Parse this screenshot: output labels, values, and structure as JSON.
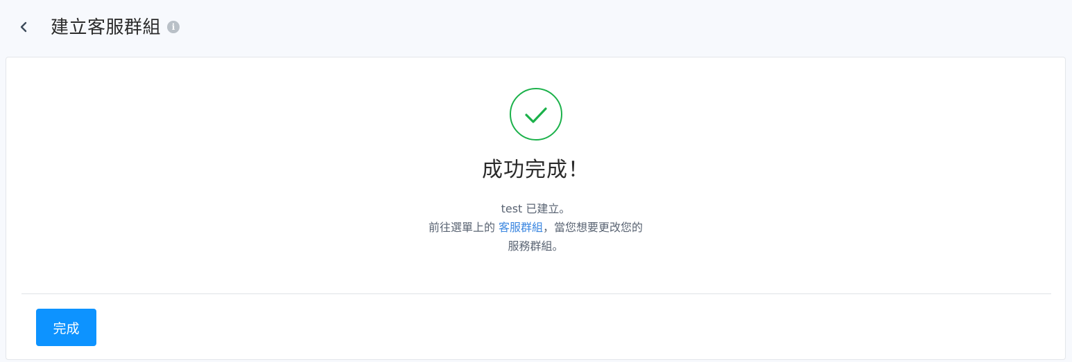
{
  "header": {
    "back_icon": "chevron-left-icon",
    "title": "建立客服群組",
    "info_icon": "info-icon",
    "info_glyph": "i"
  },
  "result": {
    "status_icon": "check-circle-icon",
    "status_color": "#1bb14a",
    "title": "成功完成！",
    "message_name": "test",
    "message_created": " 已建立。",
    "message_line2_prefix": "前往選單上的 ",
    "message_link": "客服群組",
    "message_line2_suffix": "，當您想要更改您的",
    "message_line3": "服務群組。"
  },
  "footer": {
    "done_label": "完成",
    "done_color": "#0d93ff"
  },
  "colors": {
    "background": "#f7f9fd",
    "card": "#ffffff",
    "link": "#3a86e0"
  }
}
